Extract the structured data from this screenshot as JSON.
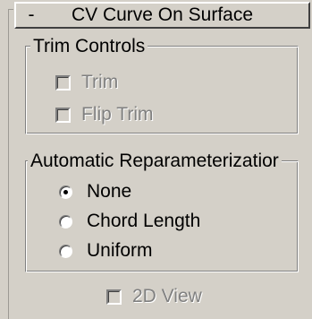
{
  "rollout": {
    "collapse_symbol": "-",
    "title": "CV Curve On Surface"
  },
  "trim_controls": {
    "legend": "Trim Controls",
    "options": [
      {
        "label": "Trim",
        "checked": false,
        "enabled": false
      },
      {
        "label": "Flip Trim",
        "checked": false,
        "enabled": false
      }
    ]
  },
  "reparam": {
    "legend": "Automatic Reparameterizatior",
    "options": [
      {
        "label": "None",
        "selected": true
      },
      {
        "label": "Chord Length",
        "selected": false
      },
      {
        "label": "Uniform",
        "selected": false
      }
    ]
  },
  "view_2d": {
    "label": "2D View",
    "checked": false,
    "enabled": false
  },
  "colors": {
    "panel_bg": "#d4d0c8",
    "disabled_text": "#808080"
  }
}
